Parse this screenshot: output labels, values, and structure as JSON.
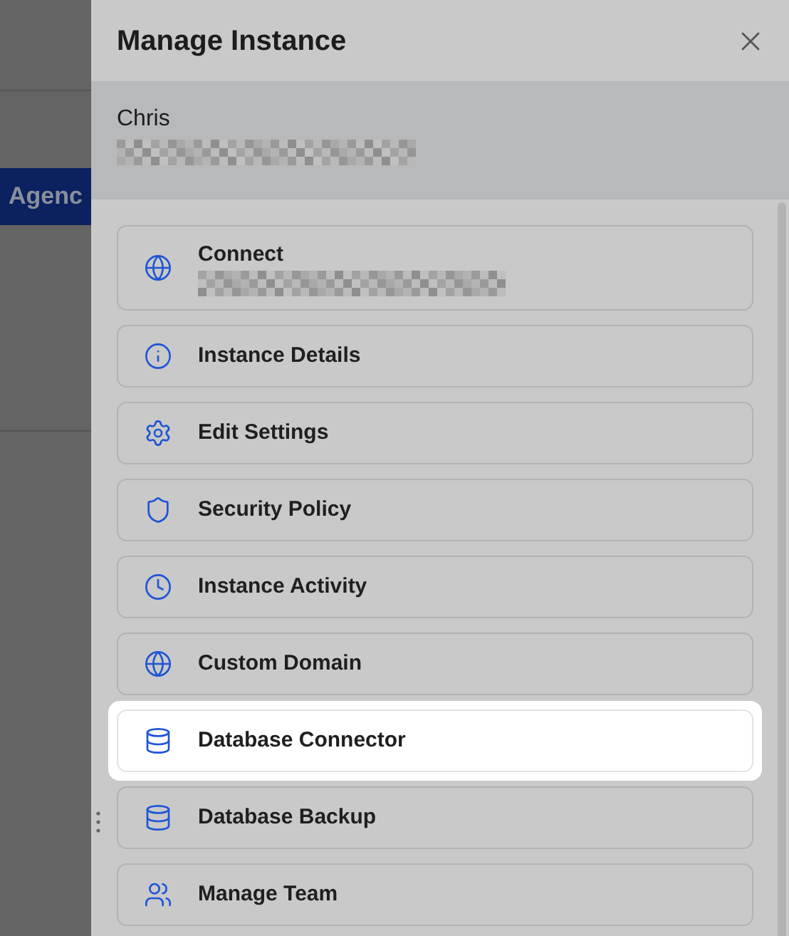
{
  "background": {
    "tab": "Agenc"
  },
  "drawer": {
    "title": "Manage Instance",
    "user": {
      "name": "Chris"
    },
    "items": [
      {
        "label": "Connect",
        "kind": "globe",
        "highlighted": false,
        "redacted_subtitle": true
      },
      {
        "label": "Instance Details",
        "kind": "info",
        "highlighted": false
      },
      {
        "label": "Edit Settings",
        "kind": "gear",
        "highlighted": false
      },
      {
        "label": "Security Policy",
        "kind": "shield",
        "highlighted": false
      },
      {
        "label": "Instance Activity",
        "kind": "clock",
        "highlighted": false
      },
      {
        "label": "Custom Domain",
        "kind": "globe",
        "highlighted": false
      },
      {
        "label": "Database Connector",
        "kind": "database",
        "highlighted": true
      },
      {
        "label": "Database Backup",
        "kind": "database",
        "highlighted": false
      },
      {
        "label": "Manage Team",
        "kind": "users",
        "highlighted": false
      }
    ]
  }
}
